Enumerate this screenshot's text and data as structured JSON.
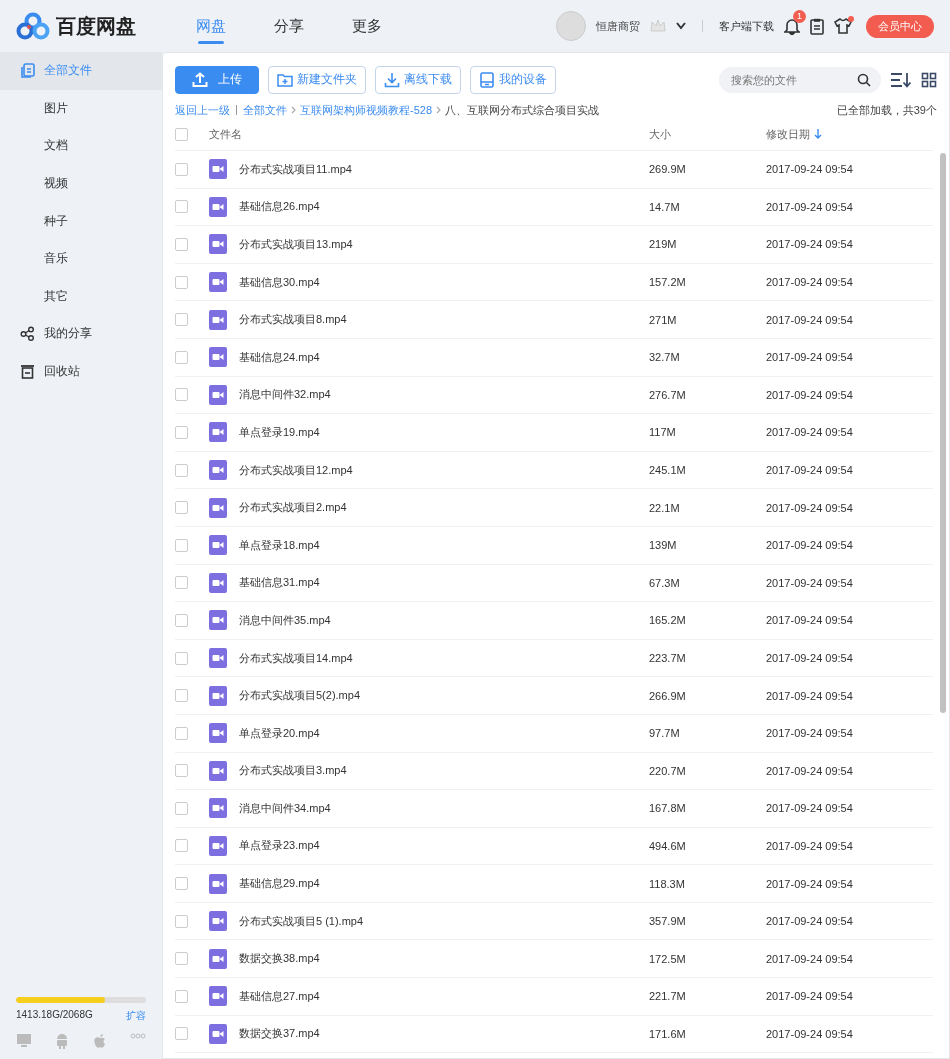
{
  "header": {
    "logo_text": "百度网盘",
    "tabs": [
      {
        "label": "网盘",
        "selected": true
      },
      {
        "label": "分享",
        "selected": false
      },
      {
        "label": "更多",
        "selected": false
      }
    ],
    "username": "恒唐商贸",
    "client_download": "客户端下载",
    "notification_badge": "1",
    "vip_button": "会员中心"
  },
  "sidebar": {
    "items": [
      {
        "label": "全部文件",
        "kind": "files",
        "selected": true
      },
      {
        "label": "图片",
        "kind": "category",
        "selected": false
      },
      {
        "label": "文档",
        "kind": "category",
        "selected": false
      },
      {
        "label": "视频",
        "kind": "category",
        "selected": false
      },
      {
        "label": "种子",
        "kind": "category",
        "selected": false
      },
      {
        "label": "音乐",
        "kind": "category",
        "selected": false
      },
      {
        "label": "其它",
        "kind": "category",
        "selected": false
      },
      {
        "label": "我的分享",
        "kind": "share",
        "selected": false
      },
      {
        "label": "回收站",
        "kind": "trash",
        "selected": false
      }
    ],
    "storage": {
      "level": 0.683,
      "text": "1413.18G/2068G",
      "expand": "扩容"
    }
  },
  "toolbar": {
    "buttons": [
      {
        "label": "上传",
        "kind": "upload"
      },
      {
        "label": "新建文件夹",
        "kind": "folder"
      },
      {
        "label": "离线下载",
        "kind": "download"
      },
      {
        "label": "我的设备",
        "kind": "device"
      }
    ],
    "search": {
      "placeholder": "搜索您的文件"
    }
  },
  "breadcrumb": {
    "items": [
      "返回上一级",
      "全部文件",
      "互联网架构师视频教程-528"
    ],
    "current": "八、互联网分布式综合项目实战",
    "status": "已全部加载，共39个"
  },
  "table": {
    "select_all_checked": false,
    "columns": [
      "文件名",
      "大小",
      "修改日期"
    ],
    "rows": [
      {
        "name": "分布式实战项目11.mp4",
        "size": "269.9M",
        "date": "2017-09-24 09:54",
        "checked": false
      },
      {
        "name": "基础信息26.mp4",
        "size": "14.7M",
        "date": "2017-09-24 09:54",
        "checked": false
      },
      {
        "name": "分布式实战项目13.mp4",
        "size": "219M",
        "date": "2017-09-24 09:54",
        "checked": false
      },
      {
        "name": "基础信息30.mp4",
        "size": "157.2M",
        "date": "2017-09-24 09:54",
        "checked": false
      },
      {
        "name": "分布式实战项目8.mp4",
        "size": "271M",
        "date": "2017-09-24 09:54",
        "checked": false
      },
      {
        "name": "基础信息24.mp4",
        "size": "32.7M",
        "date": "2017-09-24 09:54",
        "checked": false
      },
      {
        "name": "消息中间件32.mp4",
        "size": "276.7M",
        "date": "2017-09-24 09:54",
        "checked": false
      },
      {
        "name": "单点登录19.mp4",
        "size": "117M",
        "date": "2017-09-24 09:54",
        "checked": false
      },
      {
        "name": "分布式实战项目12.mp4",
        "size": "245.1M",
        "date": "2017-09-24 09:54",
        "checked": false
      },
      {
        "name": "分布式实战项目2.mp4",
        "size": "22.1M",
        "date": "2017-09-24 09:54",
        "checked": false
      },
      {
        "name": "单点登录18.mp4",
        "size": "139M",
        "date": "2017-09-24 09:54",
        "checked": false
      },
      {
        "name": "基础信息31.mp4",
        "size": "67.3M",
        "date": "2017-09-24 09:54",
        "checked": false
      },
      {
        "name": "消息中间件35.mp4",
        "size": "165.2M",
        "date": "2017-09-24 09:54",
        "checked": false
      },
      {
        "name": "分布式实战项目14.mp4",
        "size": "223.7M",
        "date": "2017-09-24 09:54",
        "checked": false
      },
      {
        "name": "分布式实战项目5(2).mp4",
        "size": "266.9M",
        "date": "2017-09-24 09:54",
        "checked": false
      },
      {
        "name": "单点登录20.mp4",
        "size": "97.7M",
        "date": "2017-09-24 09:54",
        "checked": false
      },
      {
        "name": "分布式实战项目3.mp4",
        "size": "220.7M",
        "date": "2017-09-24 09:54",
        "checked": false
      },
      {
        "name": "消息中间件34.mp4",
        "size": "167.8M",
        "date": "2017-09-24 09:54",
        "checked": false
      },
      {
        "name": "单点登录23.mp4",
        "size": "494.6M",
        "date": "2017-09-24 09:54",
        "checked": false
      },
      {
        "name": "基础信息29.mp4",
        "size": "118.3M",
        "date": "2017-09-24 09:54",
        "checked": false
      },
      {
        "name": "分布式实战项目5 (1).mp4",
        "size": "357.9M",
        "date": "2017-09-24 09:54",
        "checked": false
      },
      {
        "name": "数据交换38.mp4",
        "size": "172.5M",
        "date": "2017-09-24 09:54",
        "checked": false
      },
      {
        "name": "基础信息27.mp4",
        "size": "221.7M",
        "date": "2017-09-24 09:54",
        "checked": false
      },
      {
        "name": "数据交换37.mp4",
        "size": "171.6M",
        "date": "2017-09-24 09:54",
        "checked": false
      }
    ]
  }
}
